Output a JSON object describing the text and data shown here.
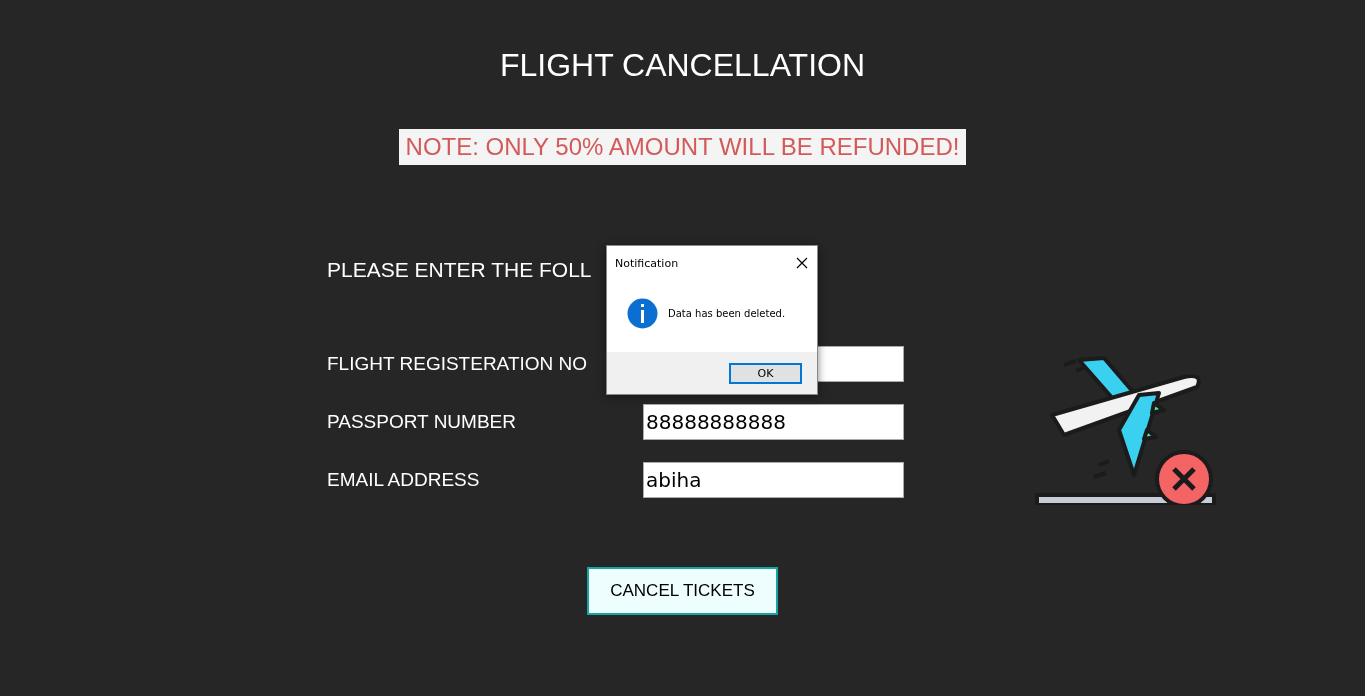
{
  "title": "FLIGHT CANCELLATION",
  "note": "NOTE: ONLY 50% AMOUNT WILL BE REFUNDED!",
  "prompt": "PLEASE ENTER THE FOLL",
  "fields": [
    {
      "label": "FLIGHT REGISTERATION NO"
    },
    {
      "label": "PASSPORT NUMBER",
      "value": "88888888888"
    },
    {
      "label": "EMAIL ADDRESS",
      "value": "abiha"
    }
  ],
  "button": "CANCEL TICKETS",
  "dialog": {
    "title": "Notification",
    "message": "Data has been deleted.",
    "button": "OK"
  }
}
